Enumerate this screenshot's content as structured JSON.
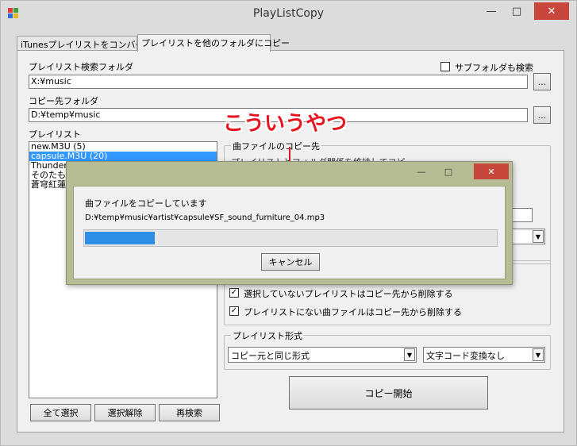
{
  "window": {
    "title": "PlayListCopy"
  },
  "tabs": [
    "iTunesプレイリストをコンバート",
    "プレイリストを他のフォルダにコピー"
  ],
  "search_folder": {
    "label": "プレイリスト検索フォルダ",
    "value": "X:¥music",
    "browse": "..."
  },
  "subfolder": {
    "label": "サブフォルダも検索",
    "checked": false
  },
  "dest_folder": {
    "label": "コピー先フォルダ",
    "value": "D:¥temp¥music",
    "browse": "..."
  },
  "playlist": {
    "label": "プレイリスト",
    "items": [
      "new.M3U (5)",
      "capsule.M3U (20)",
      "Thunder",
      "そのたもろ",
      "蒼穹紅蓮"
    ],
    "selected_index": 1
  },
  "buttons": {
    "select_all": "全て選択",
    "deselect": "選択解除",
    "research": "再検索",
    "start": "コピー開始"
  },
  "song_group": {
    "legend": "曲ファイルのコピー先",
    "hidden_option": "プレイリストとフォルダ関係を維持してコピ"
  },
  "options": {
    "delete_unselected": "選択していないプレイリストはコピー先から削除する",
    "delete_missing": "プレイリストにない曲ファイルはコピー先から削除する",
    "delete_unselected_checked": true,
    "delete_missing_checked": true
  },
  "format_group": {
    "legend": "プレイリスト形式",
    "format": "コピー元と同じ形式",
    "encoding": "文字コード変換なし"
  },
  "annotation": "こういうやつ",
  "dialog": {
    "message": "曲ファイルをコピーしています",
    "path": "D:¥temp¥music¥artist¥capsule¥SF_sound_furniture_04.mp3",
    "progress": 0.17,
    "cancel": "キャンセル"
  },
  "colors": {
    "accent": "#3399ff",
    "progress": "#2f8fe6",
    "annotation": "#e8141e",
    "close": "#c7473c",
    "dialog_frame": "#b6bd94"
  },
  "icons": {
    "minimize": "minimize-icon",
    "maximize": "maximize-icon",
    "close": "close-icon",
    "dropdown": "chevron-down-icon"
  }
}
